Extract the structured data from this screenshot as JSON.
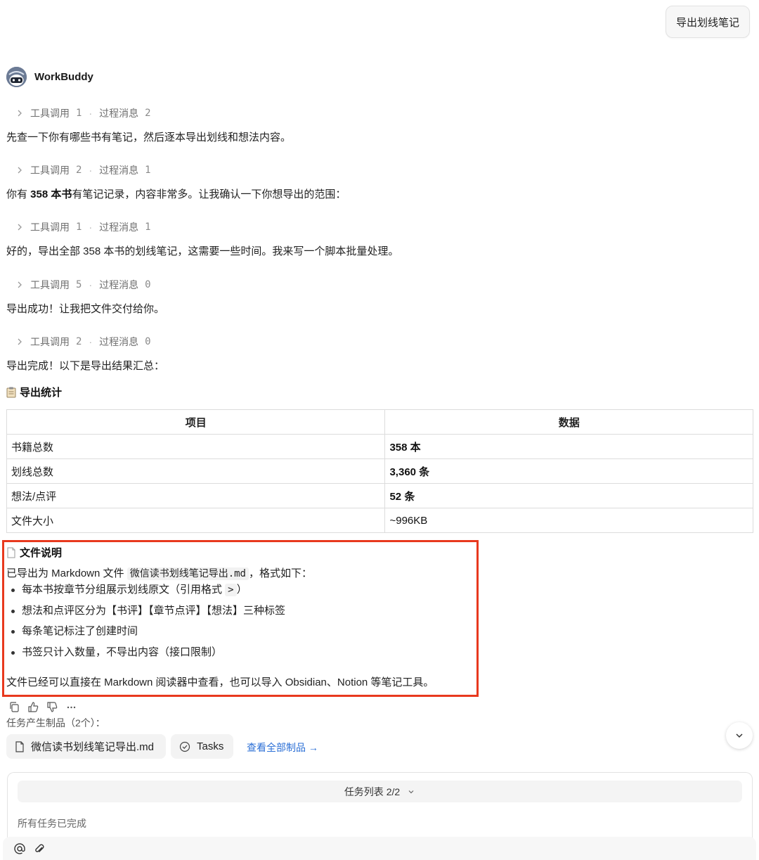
{
  "header": {
    "export_button": "导出划线笔记"
  },
  "agent": {
    "name": "WorkBuddy"
  },
  "steps": [
    {
      "tool_label": "工具调用",
      "tool_count": "1",
      "process_label": "过程消息",
      "process_count": "2",
      "message": "先查一下你有哪些书有笔记，然后逐本导出划线和想法内容。"
    },
    {
      "tool_label": "工具调用",
      "tool_count": "2",
      "process_label": "过程消息",
      "process_count": "1",
      "message_pre": "你有 ",
      "message_bold": "358 本书",
      "message_post": "有笔记记录，内容非常多。让我确认一下你想导出的范围："
    },
    {
      "tool_label": "工具调用",
      "tool_count": "1",
      "process_label": "过程消息",
      "process_count": "1",
      "message": "好的，导出全部 358 本书的划线笔记，这需要一些时间。我来写一个脚本批量处理。"
    },
    {
      "tool_label": "工具调用",
      "tool_count": "5",
      "process_label": "过程消息",
      "process_count": "0",
      "message": "导出成功！让我把文件交付给你。"
    },
    {
      "tool_label": "工具调用",
      "tool_count": "2",
      "process_label": "过程消息",
      "process_count": "0",
      "message": "导出完成！以下是导出结果汇总："
    }
  ],
  "stats": {
    "title": "导出统计",
    "headers": [
      "项目",
      "数据"
    ],
    "rows": [
      {
        "item": "书籍总数",
        "value": "358 本"
      },
      {
        "item": "划线总数",
        "value": "3,360 条"
      },
      {
        "item": "想法/点评",
        "value": "52 条"
      },
      {
        "item": "文件大小",
        "value": "~996KB"
      }
    ]
  },
  "file_info": {
    "title": "文件说明",
    "desc_pre": "已导出为 Markdown 文件 ",
    "filename": "微信读书划线笔记导出.md",
    "desc_post": "，格式如下：",
    "bullets": [
      {
        "text": "每本书按章节分组展示划线原文（引用格式 ",
        "code": ">",
        "tail": "）"
      },
      {
        "text": "想法和点评区分为【书评】【章节点评】【想法】三种标签"
      },
      {
        "text": "每条笔记标注了创建时间"
      },
      {
        "text": "书签只计入数量，不导出内容（接口限制）"
      }
    ],
    "footer": "文件已经可以直接在 Markdown 阅读器中查看，也可以导入 Obsidian、Notion 等笔记工具。"
  },
  "artifacts": {
    "label": "任务产生制品（2个）：",
    "file_chip": "微信读书划线笔记导出.md",
    "tasks_chip": "Tasks",
    "view_all": "查看全部制品 →"
  },
  "task_panel": {
    "header": "任务列表 2/2",
    "status": "所有任务已完成"
  }
}
